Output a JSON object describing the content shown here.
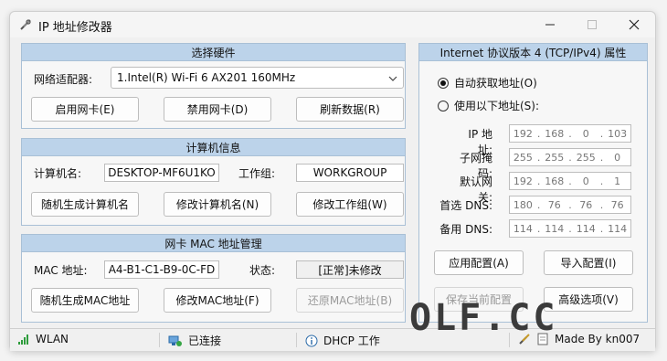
{
  "window": {
    "title": "IP 地址修改器",
    "accent": "#0078d4",
    "panel_header_color": "#bcd3ea"
  },
  "hardware": {
    "header": "选择硬件",
    "adapter_label": "网络适配器:",
    "adapter_value": "1.Intel(R) Wi-Fi 6 AX201 160MHz",
    "enable_btn": "启用网卡(E)",
    "disable_btn": "禁用网卡(D)",
    "refresh_btn": "刷新数据(R)"
  },
  "computer": {
    "header": "计算机信息",
    "name_label": "计算机名:",
    "name_value": "DESKTOP-MF6U1KO",
    "group_label": "工作组:",
    "group_value": "WORKGROUP",
    "random_btn": "随机生成计算机名",
    "rename_btn": "修改计算机名(N)",
    "group_btn": "修改工作组(W)"
  },
  "mac": {
    "header": "网卡 MAC 地址管理",
    "mac_label": "MAC 地址:",
    "mac_value": "A4-B1-C1-B9-0C-FD",
    "state_label": "状态:",
    "state_value": "[正常]未修改",
    "random_btn": "随机生成MAC地址",
    "modify_btn": "修改MAC地址(F)",
    "restore_btn": "还原MAC地址(B)"
  },
  "ipv4": {
    "header": "Internet 协议版本 4 (TCP/IPv4) 属性",
    "auto_radio": "自动获取地址(O)",
    "manual_radio": "使用以下地址(S):",
    "ip_label": "IP 地址:",
    "ip": [
      "192",
      "168",
      "0",
      "103"
    ],
    "mask_label": "子网掩码:",
    "mask": [
      "255",
      "255",
      "255",
      "0"
    ],
    "gw_label": "默认网关:",
    "gw": [
      "192",
      "168",
      "0",
      "1"
    ],
    "dns1_label": "首选 DNS:",
    "dns1": [
      "180",
      "76",
      "76",
      "76"
    ],
    "dns2_label": "备用 DNS:",
    "dns2": [
      "114",
      "114",
      "114",
      "114"
    ],
    "apply_btn": "应用配置(A)",
    "import_btn": "导入配置(I)",
    "save_btn": "保存当前配置",
    "advanced_btn": "高级选项(V)"
  },
  "status": {
    "wlan": "WLAN",
    "connected": "已连接",
    "dhcp": "DHCP 工作",
    "made_by": "Made By kn007"
  },
  "watermark": "OLF.CC"
}
